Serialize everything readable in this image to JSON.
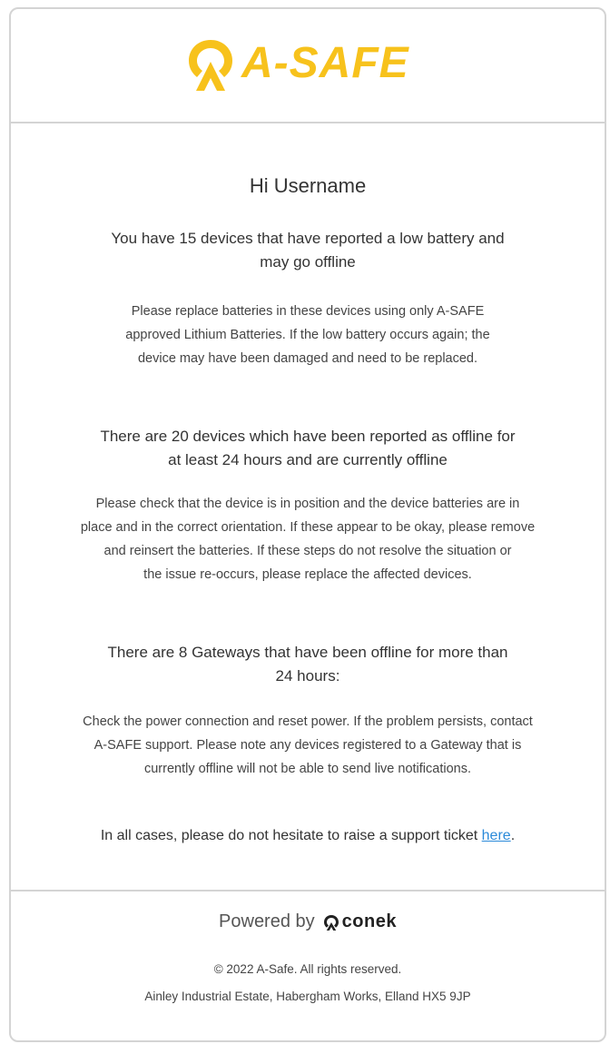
{
  "header": {
    "logo_text": "A-SAFE",
    "brand_color": "#f7c21c"
  },
  "greeting": "Hi Username",
  "sections": [
    {
      "title_line1": "You have 15 devices that have reported a low battery and",
      "title_line2": "may go offline",
      "body_lines": [
        "Please replace batteries in these devices using only A-SAFE",
        "approved Lithium Batteries. If the low battery occurs again; the",
        "device may have been damaged and need to be replaced."
      ]
    },
    {
      "title_line1": "There are 20 devices which have been reported as offline for",
      "title_line2": "at least 24 hours and are currently offline",
      "body_lines": [
        "Please check that the device is in position and the device batteries are in",
        "place and in the correct orientation. If these appear to be okay, please remove",
        "and reinsert the batteries. If these steps do not resolve the situation or",
        "the issue re-occurs, please replace the affected devices."
      ]
    },
    {
      "title_line1": "There are 8 Gateways that have been offline for more than",
      "title_line2": "24 hours:",
      "body_lines": [
        "Check the power connection and reset power. If the problem persists, contact",
        "A-SAFE support. Please note any devices registered to a Gateway that is",
        "currently offline will not be able to send live notifications."
      ]
    }
  ],
  "closing": {
    "text": "In all cases, please do not hesitate to raise a support ticket ",
    "link_text": "here",
    "end": "."
  },
  "footer": {
    "powered_by": "Powered by",
    "conek_text": "conek",
    "copyright": "© 2022 A-Safe. All rights reserved.",
    "address": "Ainley Industrial Estate, Habergham Works, Elland HX5 9JP"
  }
}
